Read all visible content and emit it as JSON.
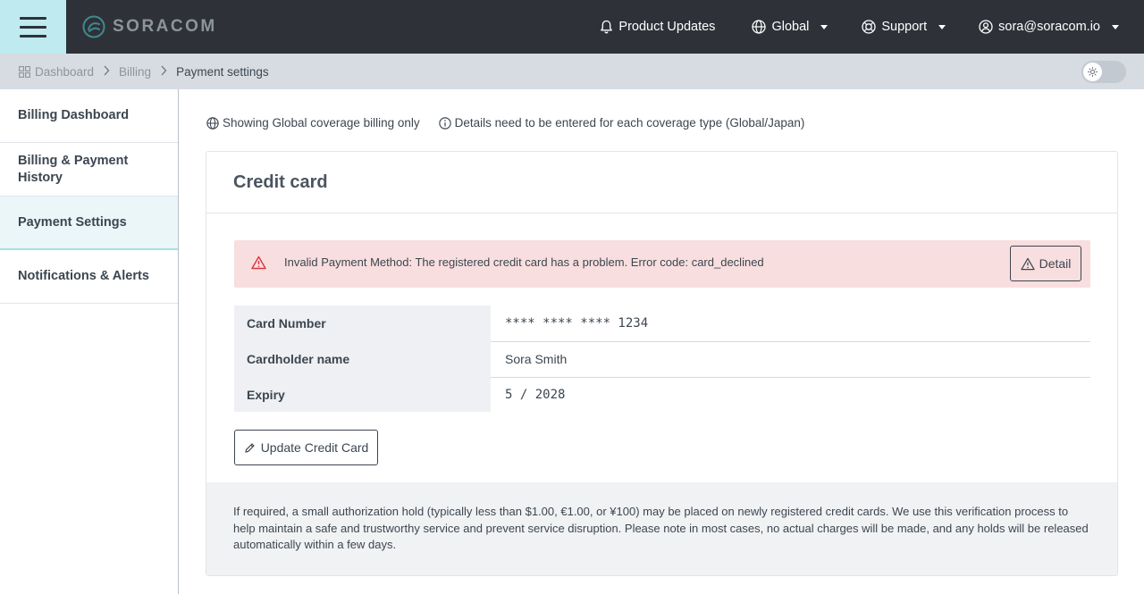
{
  "topbar": {
    "brand": "SORACOM",
    "product_updates": "Product Updates",
    "coverage": "Global",
    "support": "Support",
    "user": "sora@soracom.io"
  },
  "breadcrumb": {
    "items": [
      "Dashboard",
      "Billing",
      "Payment settings"
    ]
  },
  "sidebar": {
    "items": [
      {
        "label": "Billing Dashboard"
      },
      {
        "label": "Billing & Payment History"
      },
      {
        "label": "Payment Settings"
      },
      {
        "label": "Notifications & Alerts"
      }
    ]
  },
  "info": {
    "coverage_note": "Showing Global coverage billing only",
    "details_note": "Details need to be entered for each coverage type (Global/Japan)"
  },
  "credit_card": {
    "title": "Credit card",
    "alert": "Invalid Payment Method: The registered credit card has a problem. Error code: card_declined",
    "detail_button": "Detail",
    "rows": [
      {
        "label": "Card Number",
        "value": "**** **** **** 1234"
      },
      {
        "label": "Cardholder name",
        "value": "Sora Smith"
      },
      {
        "label": "Expiry",
        "value": "5 / 2028"
      }
    ],
    "update_button": "Update Credit Card",
    "footer": "If required, a small authorization hold (typically less than $1.00, €1.00, or ¥100) may be placed on newly registered credit cards. We use this verification process to help maintain a safe and trustworthy service and prevent service disruption. Please note in most cases, no actual charges will be made, and any holds will be released automatically within a few days."
  },
  "colors": {
    "topbar": "#2e3238",
    "menu_button": "#bfeaef",
    "alert_bg": "#f9dedf",
    "alert_icon": "#d9363e"
  },
  "icons": [
    "menu-icon",
    "soracom-logo-icon",
    "bell-icon",
    "globe-icon",
    "support-icon",
    "user-icon",
    "dashboard-grid-icon",
    "chevron-right-icon",
    "sun-icon",
    "info-icon",
    "warning-icon",
    "pencil-icon"
  ]
}
